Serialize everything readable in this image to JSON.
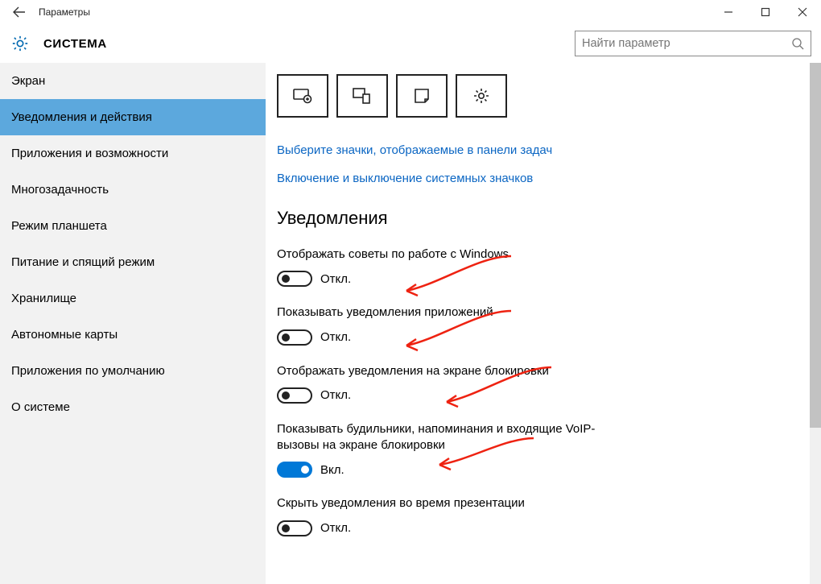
{
  "window": {
    "title": "Параметры"
  },
  "header": {
    "section": "СИСТЕМА"
  },
  "search": {
    "placeholder": "Найти параметр"
  },
  "sidebar": {
    "items": [
      {
        "label": "Экран",
        "active": false
      },
      {
        "label": "Уведомления и действия",
        "active": true
      },
      {
        "label": "Приложения и возможности",
        "active": false
      },
      {
        "label": "Многозадачность",
        "active": false
      },
      {
        "label": "Режим планшета",
        "active": false
      },
      {
        "label": "Питание и спящий режим",
        "active": false
      },
      {
        "label": "Хранилище",
        "active": false
      },
      {
        "label": "Автономные карты",
        "active": false
      },
      {
        "label": "Приложения по умолчанию",
        "active": false
      },
      {
        "label": "О системе",
        "active": false
      }
    ]
  },
  "content": {
    "links": [
      "Выберите значки, отображаемые в панели задач",
      "Включение и выключение системных значков"
    ],
    "section_heading": "Уведомления",
    "toggle_on_text": "Вкл.",
    "toggle_off_text": "Откл.",
    "settings": [
      {
        "label": "Отображать советы по работе с Windows",
        "on": false
      },
      {
        "label": "Показывать уведомления приложений",
        "on": false
      },
      {
        "label": "Отображать уведомления на экране блокировки",
        "on": false
      },
      {
        "label": "Показывать будильники, напоминания и входящие VoIP-вызовы на экране блокировки",
        "on": true
      },
      {
        "label": "Скрыть уведомления во время презентации",
        "on": false
      }
    ]
  }
}
